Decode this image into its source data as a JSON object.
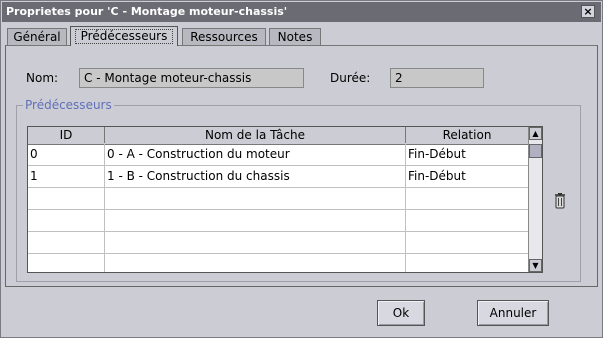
{
  "window": {
    "title": "Proprietes pour 'C - Montage moteur-chassis'"
  },
  "tabs": [
    {
      "label": "Général"
    },
    {
      "label": "Prédécesseurs"
    },
    {
      "label": "Ressources"
    },
    {
      "label": "Notes"
    }
  ],
  "form": {
    "nom_label": "Nom:",
    "nom_value": "C - Montage moteur-chassis",
    "duree_label": "Durée:",
    "duree_value": "2"
  },
  "predecessors": {
    "group_title": "Prédécesseurs",
    "columns": [
      "ID",
      "Nom de la Tâche",
      "Relation"
    ],
    "rows": [
      {
        "id": "0",
        "name": "0 - A - Construction du moteur",
        "relation": "Fin-Début"
      },
      {
        "id": "1",
        "name": "1 - B - Construction du chassis",
        "relation": "Fin-Début"
      }
    ]
  },
  "icons": {
    "delete": "trash-icon",
    "close": "close-icon"
  },
  "buttons": {
    "ok": "Ok",
    "cancel": "Annuler"
  }
}
